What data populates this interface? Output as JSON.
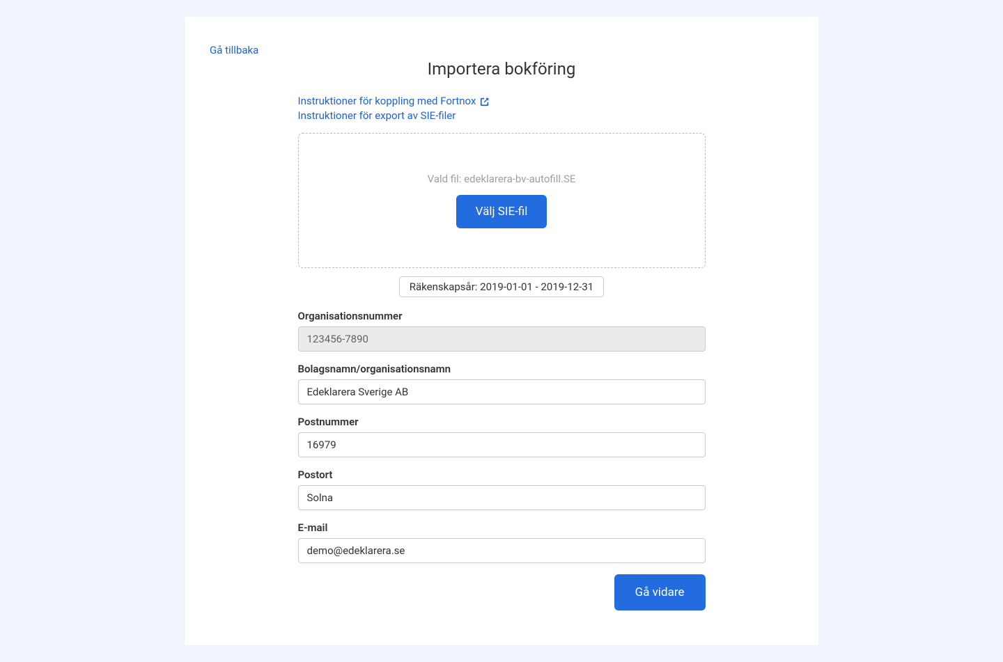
{
  "back_link": "Gå tillbaka",
  "title": "Importera bokföring",
  "instructions": {
    "fortnox": "Instruktioner för koppling med Fortnox",
    "sie_export": "Instruktioner för export av SIE-filer"
  },
  "dropzone": {
    "file_prefix": "Vald fil: ",
    "file_name": "edeklarera-bv-autofill.SE",
    "button": "Välj SIE-fil"
  },
  "fiscal_year": "Räkenskapsår: 2019-01-01 - 2019-12-31",
  "form": {
    "org_number": {
      "label": "Organisationsnummer",
      "value": "123456-7890"
    },
    "company_name": {
      "label": "Bolagsnamn/organisationsnamn",
      "value": "Edeklarera Sverige AB"
    },
    "postal_code": {
      "label": "Postnummer",
      "value": "16979"
    },
    "city": {
      "label": "Postort",
      "value": "Solna"
    },
    "email": {
      "label": "E-mail",
      "value": "demo@edeklarera.se"
    }
  },
  "submit_button": "Gå vidare"
}
